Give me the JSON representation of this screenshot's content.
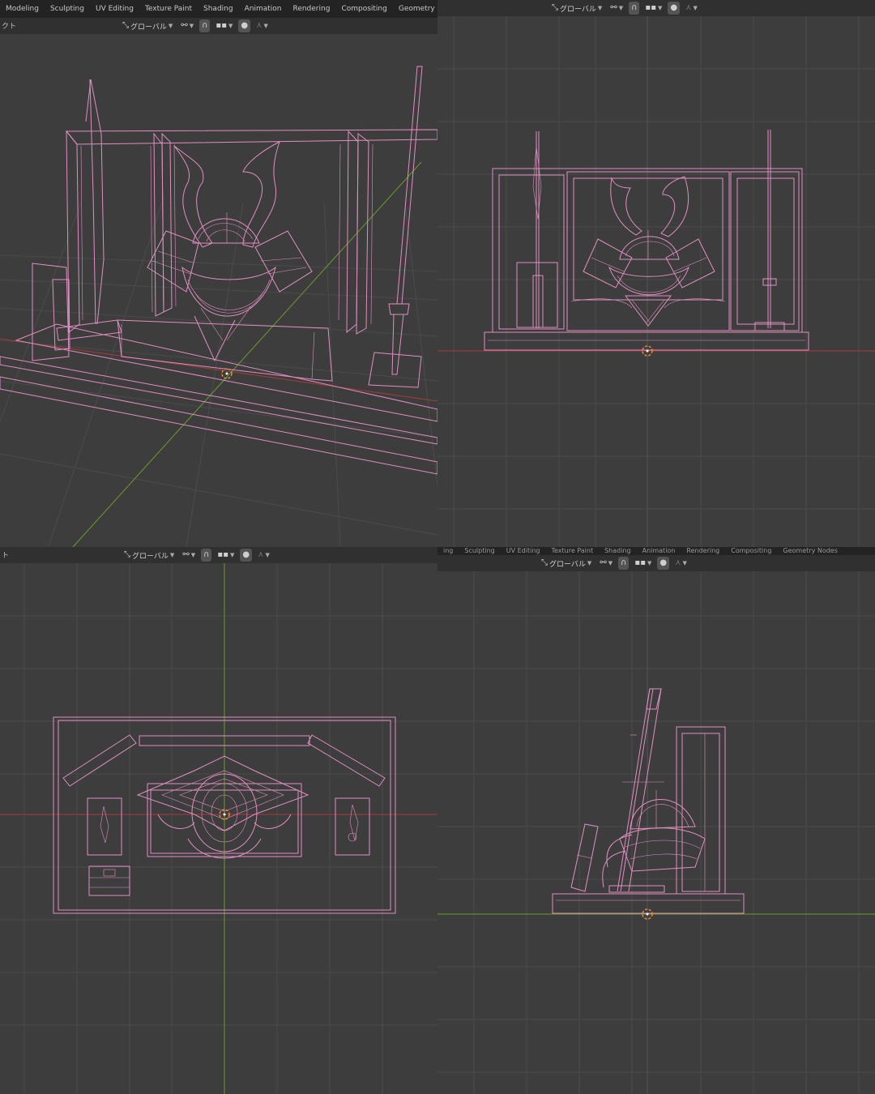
{
  "workspace_tabs": [
    "Modeling",
    "Sculpting",
    "UV Editing",
    "Texture Paint",
    "Shading",
    "Animation",
    "Rendering",
    "Compositing",
    "Geometry Nodes"
  ],
  "workspace_tabs_bottom": [
    "ing",
    "Sculpting",
    "UV Editing",
    "Texture Paint",
    "Shading",
    "Animation",
    "Rendering",
    "Compositing",
    "Geometry Nodes"
  ],
  "header_fragment_top": "クト",
  "header_fragment_bottom": "ト",
  "orientation_label": "グローバル",
  "icons": {
    "transform": "transform-orientation-icon",
    "pivot": "pivot-icon",
    "snap": "snap-icon",
    "snap_grid": "snap-grid-icon",
    "proportional": "proportional-edit-icon",
    "falloff": "falloff-icon"
  },
  "colors": {
    "wire": "#e08fc1",
    "background": "#3d3d3d",
    "x_axis": "#a83a3a",
    "y_axis": "#6a9c2e"
  }
}
